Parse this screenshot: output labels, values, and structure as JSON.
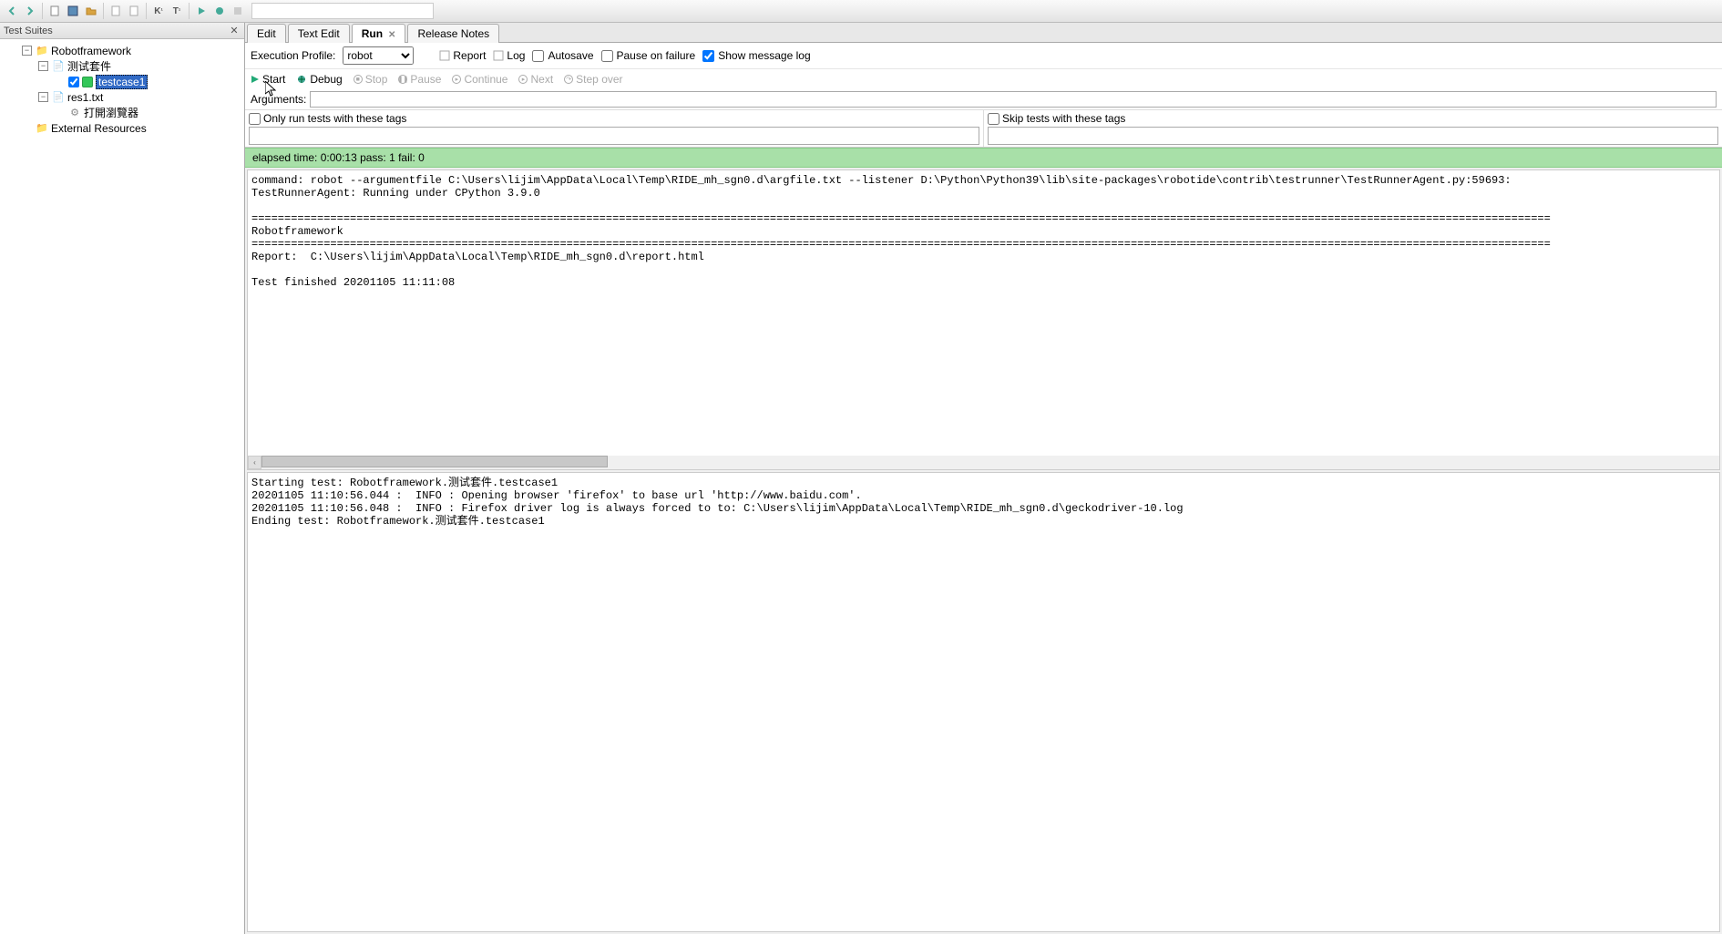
{
  "sidebar": {
    "title": "Test Suites",
    "tree": {
      "root": "Robotframework",
      "suite1": "测试套件",
      "testcase": "testcase1",
      "res": "res1.txt",
      "kw1": "打開瀏覽器",
      "ext": "External Resources"
    }
  },
  "tabs": {
    "edit": "Edit",
    "textedit": "Text Edit",
    "run": "Run",
    "release": "Release Notes"
  },
  "run": {
    "profile_label": "Execution Profile:",
    "profile_value": "robot",
    "report": "Report",
    "log": "Log",
    "autosave": "Autosave",
    "pause_fail": "Pause on failure",
    "show_msg": "Show message log",
    "start": "Start",
    "debug": "Debug",
    "stop": "Stop",
    "pause": "Pause",
    "continue": "Continue",
    "next": "Next",
    "stepover": "Step over",
    "arguments": "Arguments:",
    "only_tags": "Only run tests with these tags",
    "skip_tags": "Skip tests with these tags"
  },
  "status": "elapsed time: 0:00:13     pass: 1     fail: 0",
  "output1": "command: robot --argumentfile C:\\Users\\lijim\\AppData\\Local\\Temp\\RIDE_mh_sgn0.d\\argfile.txt --listener D:\\Python\\Python39\\lib\\site-packages\\robotide\\contrib\\testrunner\\TestRunnerAgent.py:59693:\nTestRunnerAgent: Running under CPython 3.9.0\n\n======================================================================================================================================================================================================\nRobotframework\n======================================================================================================================================================================================================\nReport:  C:\\Users\\lijim\\AppData\\Local\\Temp\\RIDE_mh_sgn0.d\\report.html\n\nTest finished 20201105 11:11:08",
  "output2": "Starting test: Robotframework.测试套件.testcase1\n20201105 11:10:56.044 :  INFO : Opening browser 'firefox' to base url 'http://www.baidu.com'.\n20201105 11:10:56.048 :  INFO : Firefox driver log is always forced to to: C:\\Users\\lijim\\AppData\\Local\\Temp\\RIDE_mh_sgn0.d\\geckodriver-10.log\nEnding test: Robotframework.测试套件.testcase1"
}
